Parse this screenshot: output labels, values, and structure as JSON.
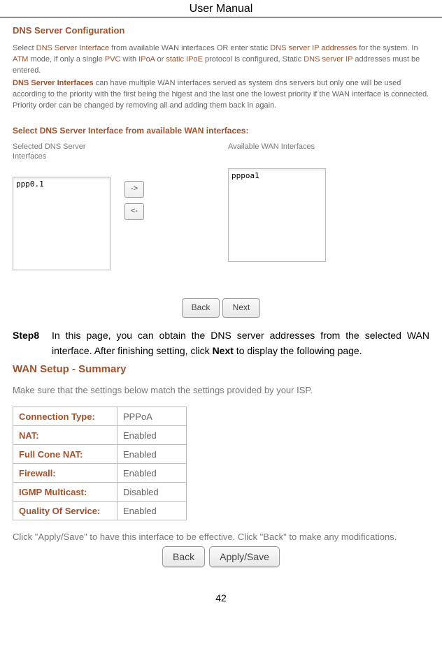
{
  "header": {
    "title": "User Manual"
  },
  "shot1": {
    "title": "DNS Server Configuration",
    "p1_a": "Select ",
    "p1_b": "DNS Server Interface",
    "p1_c": " from available WAN interfaces OR enter static ",
    "p1_d": "DNS server IP addresses",
    "p1_e": " for the system. In ",
    "p1_f": "ATM",
    "p1_g": " mode, if only a single ",
    "p1_h": "PVC",
    "p1_i": " with ",
    "p1_j": "IPoA",
    "p1_k": " or ",
    "p1_l": "static IPoE",
    "p1_m": " protocol is configured, Static ",
    "p1_n": "DNS server IP",
    "p1_o": " addresses must be entered.",
    "p2_a": "DNS Server Interfaces",
    "p2_b": " can have multiple WAN interfaces served as system dns servers but only one will be used according to the priority with the first being the higest and the last one the lowest priority if the WAN interface is connected. Priority order can be changed by removing all and adding them back in again.",
    "subheading": "Select DNS Server Interface from available WAN interfaces:",
    "left_label_a": "Selected DNS Server",
    "left_label_b": "Interfaces",
    "right_label": "Available WAN Interfaces",
    "left_item": "ppp0.1",
    "right_item": "pppoa1",
    "arr_right": "->",
    "arr_left": "<-",
    "back": "Back",
    "next": "Next"
  },
  "step": {
    "label": "Step8",
    "t1": "In this page, you can obtain the DNS server addresses from the selected WAN interface. After finishing setting, click ",
    "t_next": "Next",
    "t2": " to display the following page."
  },
  "shot2": {
    "title": "WAN Setup - Summary",
    "note": "Make sure that the settings below match the settings provided by your ISP.",
    "rows": [
      {
        "k": "Connection Type:",
        "v": "PPPoA"
      },
      {
        "k": "NAT:",
        "v": "Enabled"
      },
      {
        "k": "Full Cone NAT:",
        "v": "Enabled"
      },
      {
        "k": "Firewall:",
        "v": "Enabled"
      },
      {
        "k": "IGMP Multicast:",
        "v": "Disabled"
      },
      {
        "k": "Quality Of Service:",
        "v": "Enabled"
      }
    ],
    "bottom": "Click \"Apply/Save\" to have this interface to be effective. Click \"Back\" to make any modifications.",
    "back": "Back",
    "apply": "Apply/Save"
  },
  "footer": {
    "page": "42"
  }
}
